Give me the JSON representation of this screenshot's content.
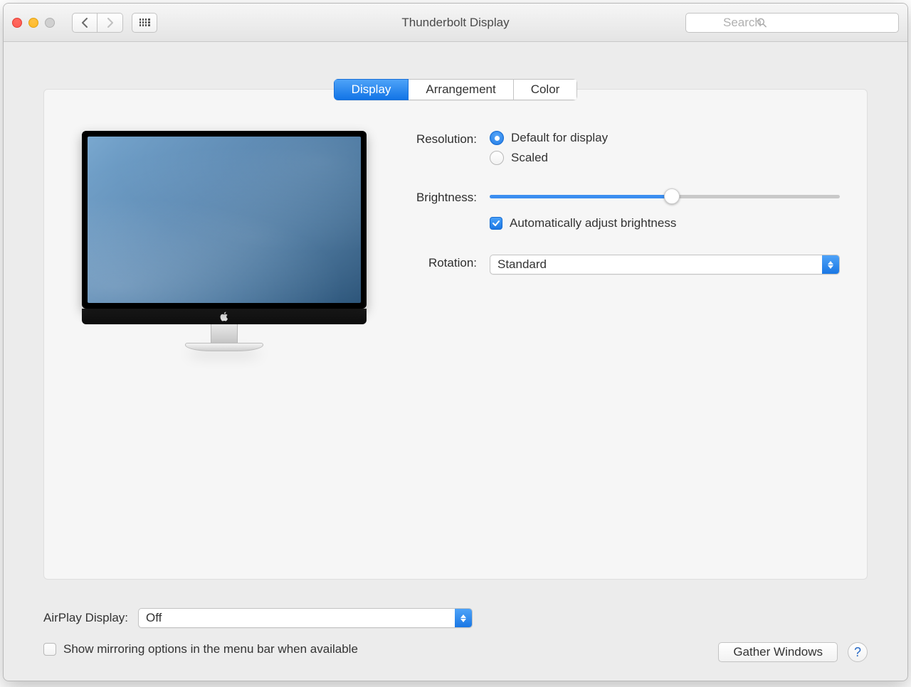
{
  "window": {
    "title": "Thunderbolt Display"
  },
  "toolbar": {
    "search_placeholder": "Search"
  },
  "tabs": {
    "display": "Display",
    "arrangement": "Arrangement",
    "color": "Color",
    "active": "display"
  },
  "labels": {
    "resolution": "Resolution:",
    "brightness": "Brightness:",
    "rotation": "Rotation:",
    "airplay": "AirPlay Display:"
  },
  "resolution": {
    "default": "Default for display",
    "scaled": "Scaled",
    "selected": "default"
  },
  "brightness": {
    "percent": 52,
    "auto_label": "Automatically adjust brightness",
    "auto_checked": true
  },
  "rotation": {
    "value": "Standard"
  },
  "airplay": {
    "value": "Off"
  },
  "mirroring": {
    "label": "Show mirroring options in the menu bar when available",
    "checked": false
  },
  "buttons": {
    "gather": "Gather Windows",
    "help": "?"
  }
}
